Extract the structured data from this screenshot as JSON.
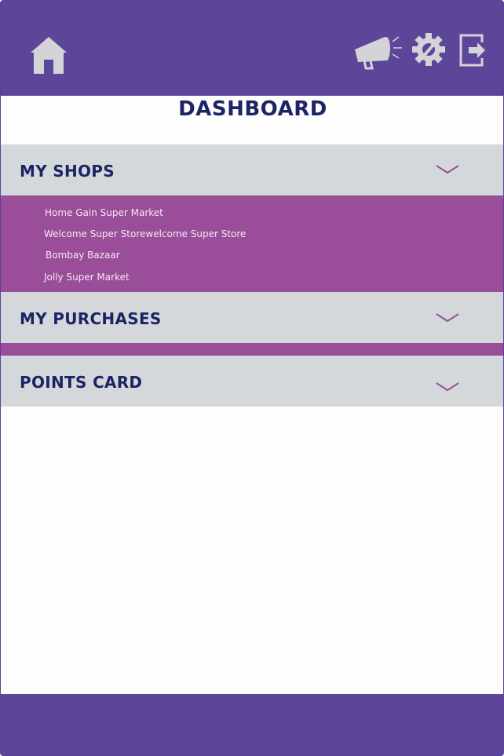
{
  "header": {
    "title": "DASHBOARD",
    "icons": [
      "home-icon",
      "megaphone-icon",
      "gear-icon",
      "exit-icon"
    ]
  },
  "sections": {
    "shops": {
      "label": "MY SHOPS",
      "items": [
        {
          "label": "Home Gain Super Market"
        },
        {
          "label": "Welcome Super Storewelcome Super Store"
        },
        {
          "label": "Bombay Bazaar"
        },
        {
          "label": "Jolly Super Market"
        }
      ]
    },
    "purchases": {
      "label": "MY PURCHASES"
    },
    "points": {
      "label": "POINTS CARD"
    }
  },
  "colors": {
    "topbar": "#5d4599",
    "accent": "#9a4d98",
    "section_header": "#d5d8da",
    "title_text": "#1c2466",
    "icon": "#d3d3d8"
  }
}
